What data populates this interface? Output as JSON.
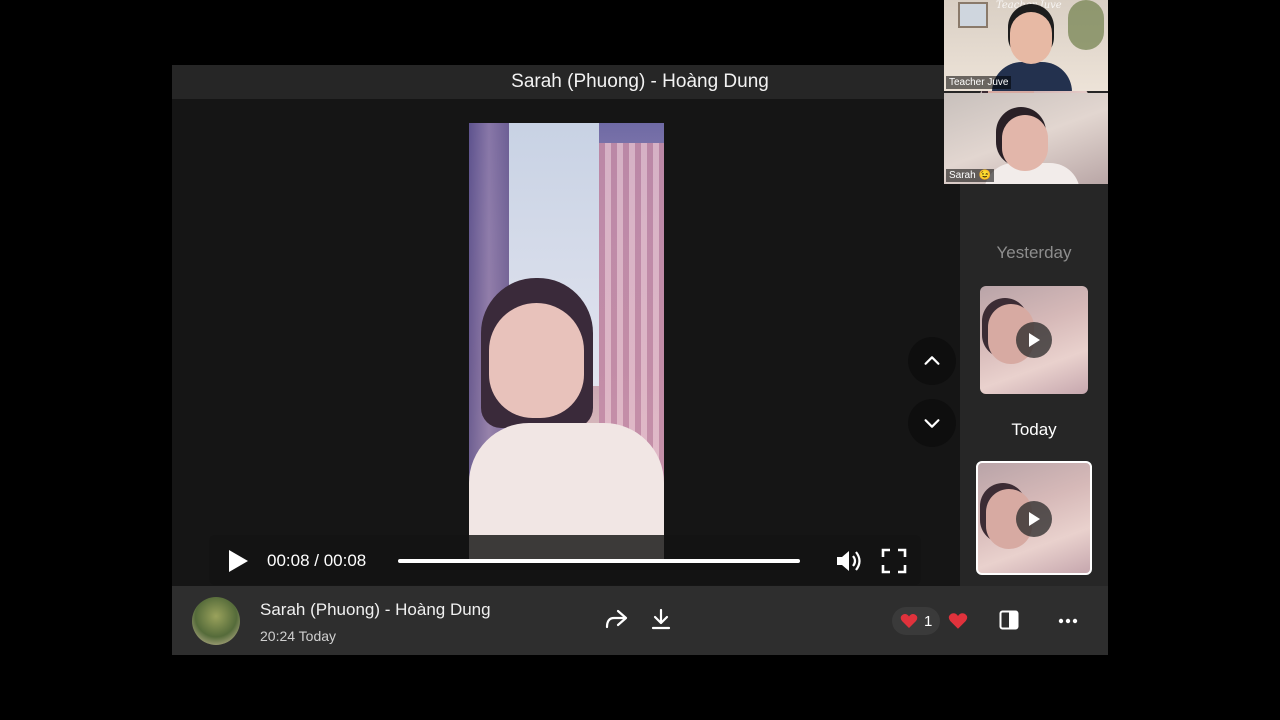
{
  "viewer": {
    "title": "Sarah (Phuong) - Hoàng Dung"
  },
  "player": {
    "time": "00:08 / 00:08",
    "progress_fraction": 1.0
  },
  "sidebar": {
    "yesterday_label": "Yesterday",
    "today_label": "Today"
  },
  "footer": {
    "sender": "Sarah (Phuong) - Hoàng Dung",
    "sent_time": "20:24 Today",
    "reaction_count": "1"
  },
  "call": {
    "participants": [
      {
        "name": "Teacher Juve"
      },
      {
        "name": "Sarah 😉"
      }
    ],
    "overlay_text": "Teacher Juve"
  },
  "colors": {
    "heart": "#e0323c",
    "panel": "#262626",
    "stage": "#151515"
  },
  "icons": [
    "play-icon",
    "volume-icon",
    "fullscreen-icon",
    "chevron-up-icon",
    "chevron-down-icon",
    "share-icon",
    "download-icon",
    "heart-icon",
    "sidebar-toggle-icon",
    "more-icon"
  ]
}
